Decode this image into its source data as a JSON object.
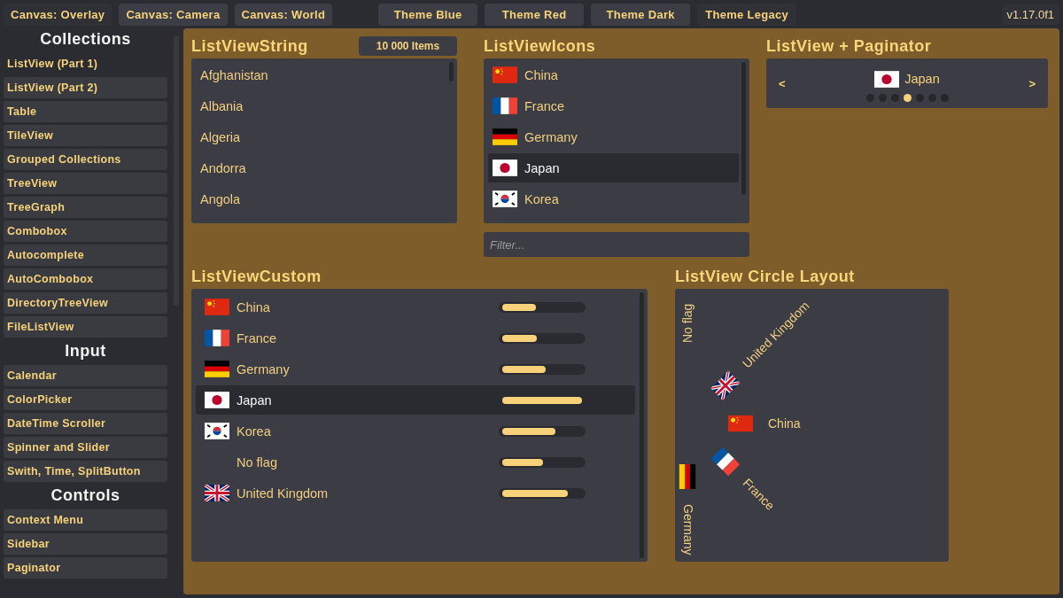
{
  "toolbar": {
    "canvas_buttons": [
      {
        "label": "Canvas: Overlay",
        "selected": true
      },
      {
        "label": "Canvas: Camera",
        "selected": false
      },
      {
        "label": "Canvas: World",
        "selected": false
      }
    ],
    "theme_buttons": [
      {
        "label": "Theme Blue",
        "selected": false
      },
      {
        "label": "Theme Red",
        "selected": false
      },
      {
        "label": "Theme Dark",
        "selected": false
      },
      {
        "label": "Theme Legacy",
        "selected": true
      }
    ],
    "version": "v1.17.0f1"
  },
  "sidebar": {
    "sections": [
      {
        "title": "Collections",
        "items": [
          {
            "label": "ListView (Part 1)",
            "selected": true
          },
          {
            "label": "ListView (Part 2)",
            "selected": false
          },
          {
            "label": "Table",
            "selected": false
          },
          {
            "label": "TileView",
            "selected": false
          },
          {
            "label": "Grouped Collections",
            "selected": false
          },
          {
            "label": "TreeView",
            "selected": false
          },
          {
            "label": "TreeGraph",
            "selected": false
          },
          {
            "label": "Combobox",
            "selected": false
          },
          {
            "label": "Autocomplete",
            "selected": false
          },
          {
            "label": "AutoCombobox",
            "selected": false
          },
          {
            "label": "DirectoryTreeView",
            "selected": false
          },
          {
            "label": "FileListView",
            "selected": false
          }
        ]
      },
      {
        "title": "Input",
        "items": [
          {
            "label": "Calendar",
            "selected": false
          },
          {
            "label": "ColorPicker",
            "selected": false
          },
          {
            "label": "DateTime Scroller",
            "selected": false
          },
          {
            "label": "Spinner and Slider",
            "selected": false
          },
          {
            "label": "Swith, Time, SplitButton",
            "selected": false
          }
        ]
      },
      {
        "title": "Controls",
        "items": [
          {
            "label": "Context Menu",
            "selected": false
          },
          {
            "label": "Sidebar",
            "selected": false
          },
          {
            "label": "Paginator",
            "selected": false
          }
        ]
      }
    ]
  },
  "list_view_string": {
    "title": "ListViewString",
    "count_badge": "10 000 Items",
    "items": [
      {
        "label": "Afghanistan",
        "selected": false
      },
      {
        "label": "Albania",
        "selected": false
      },
      {
        "label": "Algeria",
        "selected": false
      },
      {
        "label": "Andorra",
        "selected": false
      },
      {
        "label": "Angola",
        "selected": false
      }
    ]
  },
  "list_view_icons": {
    "title": "ListViewIcons",
    "items": [
      {
        "label": "China",
        "kind": "cn",
        "selected": false
      },
      {
        "label": "France",
        "kind": "fr",
        "selected": false
      },
      {
        "label": "Germany",
        "kind": "de",
        "selected": false
      },
      {
        "label": "Japan",
        "kind": "jp",
        "selected": true
      },
      {
        "label": "Korea",
        "kind": "kr",
        "selected": false
      }
    ],
    "filter": {
      "placeholder": "Filter..."
    }
  },
  "paginator": {
    "title": "ListView + Paginator",
    "current": {
      "label": "Japan",
      "kind": "jp"
    },
    "prev": "<",
    "next": ">",
    "pages": [
      {
        "selected": false
      },
      {
        "selected": false
      },
      {
        "selected": false
      },
      {
        "selected": true
      },
      {
        "selected": false
      },
      {
        "selected": false
      },
      {
        "selected": false
      }
    ]
  },
  "list_view_custom": {
    "title": "ListViewCustom",
    "items": [
      {
        "label": "China",
        "kind": "cn",
        "level": 0.42,
        "selected": false
      },
      {
        "label": "France",
        "kind": "fr",
        "level": 0.43,
        "selected": false
      },
      {
        "label": "Germany",
        "kind": "de",
        "level": 0.54,
        "selected": false
      },
      {
        "label": "Japan",
        "kind": "jp",
        "level": 1,
        "selected": true
      },
      {
        "label": "Korea",
        "kind": "kr",
        "level": 0.67,
        "selected": false
      },
      {
        "label": "No flag",
        "kind": "none",
        "level": 0.51,
        "selected": false
      },
      {
        "label": "United Kingdom",
        "kind": "gb",
        "level": 0.82,
        "selected": false
      }
    ]
  },
  "circle_layout": {
    "title": "ListView Circle Layout",
    "items": [
      {
        "label": "No flag",
        "kind": "none"
      },
      {
        "label": "United Kingdom",
        "kind": "gb"
      },
      {
        "label": "China",
        "kind": "cn"
      },
      {
        "label": "France",
        "kind": "fr"
      },
      {
        "label": "Germany",
        "kind": "de"
      }
    ]
  }
}
